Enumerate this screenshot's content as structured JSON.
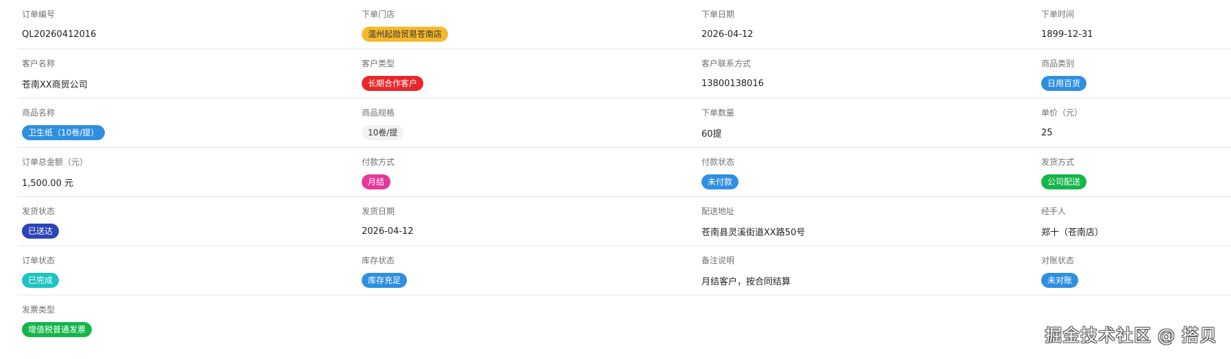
{
  "rows": [
    [
      {
        "label": "订单编号",
        "value": "QL20260412016"
      },
      {
        "label": "下单门店",
        "value": "温州起勋贸易苍南店",
        "tag": {
          "bg": "#f5b92c",
          "fg": "#333333"
        }
      },
      {
        "label": "下单日期",
        "value": "2026-04-12"
      },
      {
        "label": "下单时间",
        "value": "1899-12-31"
      }
    ],
    [
      {
        "label": "客户名称",
        "value": "苍南XX商贸公司"
      },
      {
        "label": "客户类型",
        "value": "长期合作客户",
        "tag": {
          "bg": "#e8272b",
          "fg": "#ffffff"
        }
      },
      {
        "label": "客户联系方式",
        "value": "13800138016"
      },
      {
        "label": "商品类别",
        "value": "日用百货",
        "tag": {
          "bg": "#2f8fe0",
          "fg": "#ffffff"
        }
      }
    ],
    [
      {
        "label": "商品名称",
        "value": "卫生纸（10卷/提）",
        "tag": {
          "bg": "#2f8fe0",
          "fg": "#ffffff"
        }
      },
      {
        "label": "商品规格",
        "value": "10卷/提",
        "tag": {
          "bg": "#f2f2f2",
          "fg": "#333333"
        }
      },
      {
        "label": "下单数量",
        "value": "60提"
      },
      {
        "label": "单价（元）",
        "value": "25"
      }
    ],
    [
      {
        "label": "订单总金额（元）",
        "value": "1,500.00 元"
      },
      {
        "label": "付款方式",
        "value": "月结",
        "tag": {
          "bg": "#e4389b",
          "fg": "#ffffff"
        }
      },
      {
        "label": "付款状态",
        "value": "未付款",
        "tag": {
          "bg": "#2f8fe0",
          "fg": "#ffffff"
        }
      },
      {
        "label": "发货方式",
        "value": "公司配送",
        "tag": {
          "bg": "#13b64a",
          "fg": "#ffffff"
        }
      }
    ],
    [
      {
        "label": "发货状态",
        "value": "已送达",
        "tag": {
          "bg": "#2d44b5",
          "fg": "#ffffff"
        }
      },
      {
        "label": "发货日期",
        "value": "2026-04-12"
      },
      {
        "label": "配送地址",
        "value": "苍南县灵溪街道XX路50号"
      },
      {
        "label": "经手人",
        "value": "郑十（苍南店）"
      }
    ],
    [
      {
        "label": "订单状态",
        "value": "已完成",
        "tag": {
          "bg": "#1ec3c3",
          "fg": "#ffffff"
        }
      },
      {
        "label": "库存状态",
        "value": "库存充足",
        "tag": {
          "bg": "#2f8fe0",
          "fg": "#ffffff"
        }
      },
      {
        "label": "备注说明",
        "value": "月结客户，按合同结算"
      },
      {
        "label": "对账状态",
        "value": "未对账",
        "tag": {
          "bg": "#2f8fe0",
          "fg": "#ffffff"
        }
      }
    ],
    [
      {
        "label": "发票类型",
        "value": "增值税普通发票",
        "tag": {
          "bg": "#13b64a",
          "fg": "#ffffff"
        }
      }
    ]
  ],
  "watermark": "掘金技术社区 @ 搭贝"
}
